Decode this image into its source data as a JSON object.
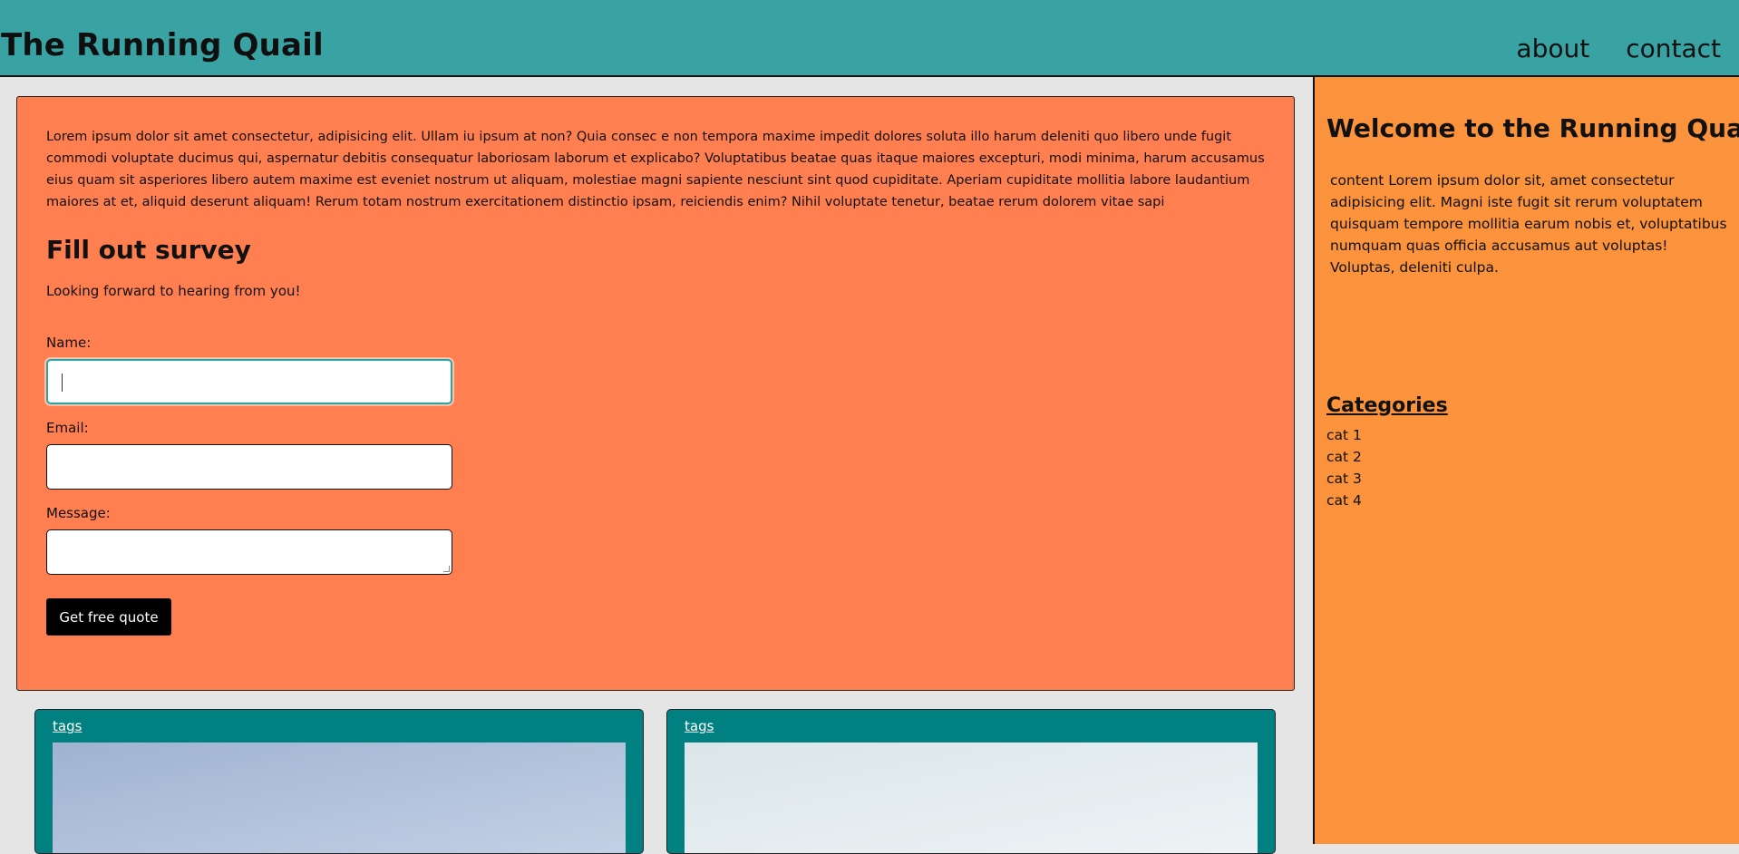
{
  "header": {
    "site_title": "The Running Quail",
    "nav": [
      "about",
      "contact"
    ]
  },
  "main": {
    "intro": "Lorem ipsum dolor sit amet consectetur, adipisicing elit. Ullam iu ipsum at non? Quia consec e non tempora maxime impedit dolores soluta illo harum deleniti quo libero unde fugit commodi voluptate ducimus qui, aspernatur debitis consequatur laboriosam laborum et explicabo? Voluptatibus beatae quas itaque maiores excepturi, modi minima, harum accusamus eius quam sit asperiores libero autem maxime est eveniet nostrum ut aliquam, molestiae magni sapiente nesciunt sint quod cupiditate. Aperiam cupiditate mollitia labore laudantium maiores at et, aliquid deserunt aliquam! Rerum totam nostrum exercitationem distinctio ipsam, reiciendis enim? Nihil voluptate tenetur, beatae rerum dolorem vitae sapi",
    "survey_title": "Fill out survey",
    "survey_subtitle": "Looking forward to hearing from you!",
    "form": {
      "name_label": "Name:",
      "name_value": "",
      "email_label": "Email:",
      "email_value": "",
      "message_label": "Message:",
      "message_value": "",
      "submit_label": "Get free quote"
    }
  },
  "sidebar": {
    "welcome_title": "Welcome to the Running Quail!",
    "welcome_text": "content Lorem ipsum dolor sit, amet consectetur adipisicing elit. Magni iste fugit sit rerum voluptatem quisquam tempore mollitia earum nobis et, voluptatibus numquam quas officia accusamus aut voluptas! Voluptas, deleniti culpa.",
    "categories_title": "Categories",
    "categories": [
      "cat 1",
      "cat 2",
      "cat 3",
      "cat 4"
    ]
  },
  "posts": [
    {
      "tag_label": "tags"
    },
    {
      "tag_label": "tags"
    }
  ],
  "colors": {
    "header": "#39a2a3",
    "main_card": "#ff7f50",
    "sidebar": "#fb923c",
    "post_card": "#008080",
    "page_bg": "#e5e5e5"
  }
}
